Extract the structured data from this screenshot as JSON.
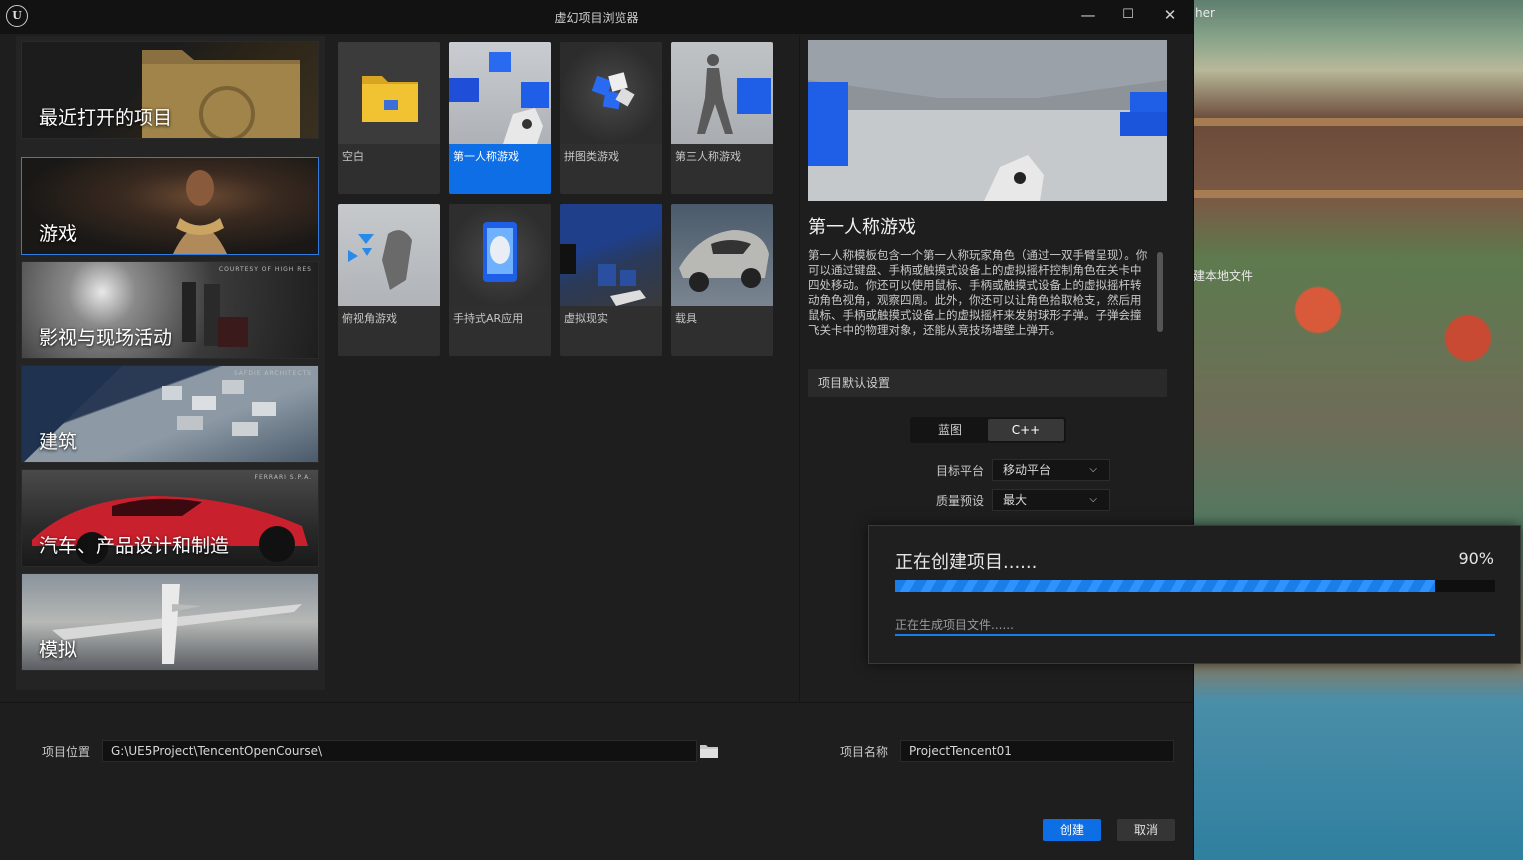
{
  "window": {
    "title": "虚幻项目浏览器",
    "minimize": "—",
    "maximize": "☐",
    "close": "✕"
  },
  "background": {
    "fragments": [
      "her",
      "建本地文件"
    ]
  },
  "categories": [
    {
      "label": "最近打开的项目",
      "credit": ""
    },
    {
      "label": "游戏",
      "credit": "",
      "selected": true
    },
    {
      "label": "影视与现场活动",
      "credit": "COURTESY OF HIGH RES"
    },
    {
      "label": "建筑",
      "credit": "SAFDIE ARCHITECTS"
    },
    {
      "label": "汽车、产品设计和制造",
      "credit": "FERRARI S.P.A."
    },
    {
      "label": "模拟",
      "credit": ""
    }
  ],
  "templates": [
    {
      "name": "空白"
    },
    {
      "name": "第一人称游戏",
      "selected": true
    },
    {
      "name": "拼图类游戏"
    },
    {
      "name": "第三人称游戏"
    },
    {
      "name": "俯视角游戏"
    },
    {
      "name": "手持式AR应用"
    },
    {
      "name": "虚拟现实"
    },
    {
      "name": "载具"
    }
  ],
  "details": {
    "title": "第一人称游戏",
    "description": "第一人称模板包含一个第一人称玩家角色（通过一双手臂呈现）。你可以通过键盘、手柄或触摸式设备上的虚拟摇杆控制角色在关卡中四处移动。你还可以使用鼠标、手柄或触摸式设备上的虚拟摇杆转动角色视角，观察四周。此外，你还可以让角色拾取枪支，然后用鼠标、手柄或触摸式设备上的虚拟摇杆来发射球形子弹。子弹会撞飞关卡中的物理对象，还能从竞技场墙壁上弹开。",
    "settings_header": "项目默认设置",
    "lang_options": [
      "蓝图",
      "C++"
    ],
    "lang_selected": "C++",
    "target_platform_label": "目标平台",
    "target_platform_value": "移动平台",
    "quality_label": "质量预设",
    "quality_value": "最大"
  },
  "bottom": {
    "location_label": "项目位置",
    "location_value": "G:\\UE5Project\\TencentOpenCourse\\",
    "name_label": "项目名称",
    "name_value": "ProjectTencent01",
    "create": "创建",
    "cancel": "取消"
  },
  "progress": {
    "title": "正在创建项目......",
    "percent_text": "90%",
    "fraction": 0.9,
    "subtitle": "正在生成项目文件......"
  },
  "colors": {
    "accent": "#0e6ee6",
    "progress": "#1b7de8"
  }
}
